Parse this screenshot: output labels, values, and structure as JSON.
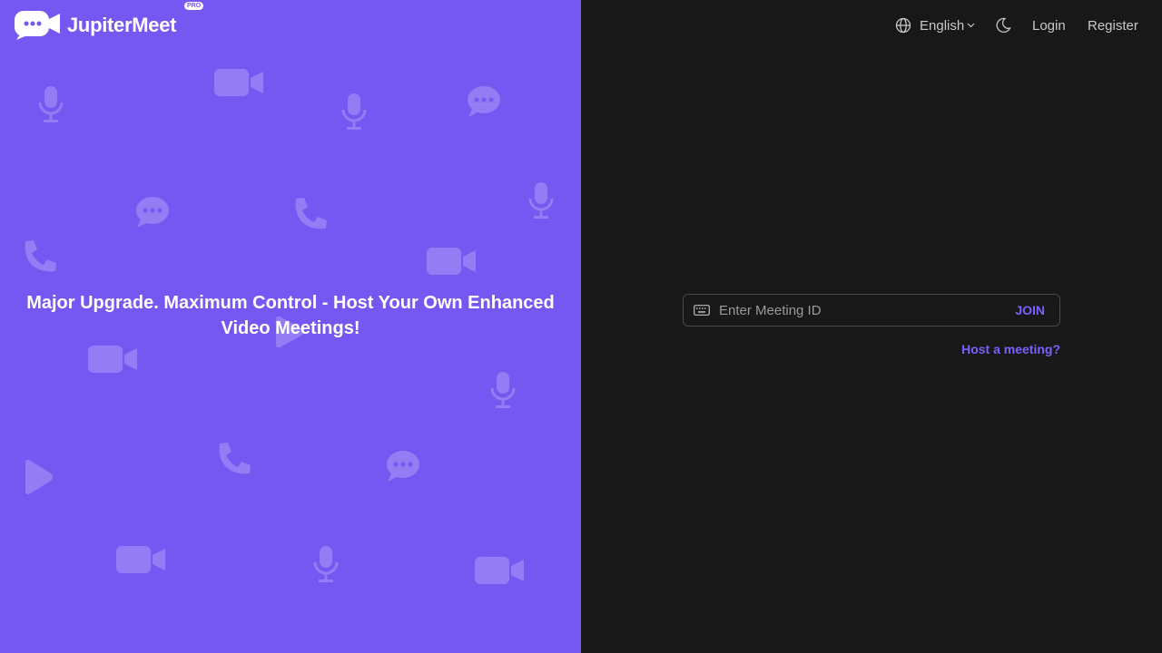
{
  "brand": {
    "name": "JupiterMeet",
    "badge": "PRO",
    "logo_icon": "video-chat-icon"
  },
  "hero": {
    "headline": "Major Upgrade. Maximum Control - Host Your Own Enhanced Video Meetings!"
  },
  "nav": {
    "language_icon": "globe-icon",
    "language": "English",
    "theme_icon": "moon-icon",
    "login": "Login",
    "register": "Register"
  },
  "join": {
    "input_icon": "keyboard-icon",
    "placeholder": "Enter Meeting ID",
    "value": "",
    "button": "JOIN",
    "host_link": "Host a meeting?"
  },
  "colors": {
    "accent": "#7557f1",
    "link": "#7b61ff",
    "dark_bg": "#181818"
  }
}
